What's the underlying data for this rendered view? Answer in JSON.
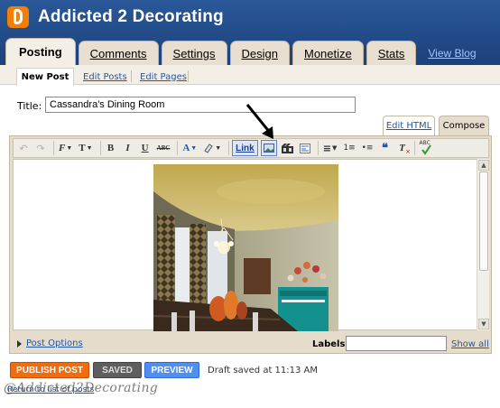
{
  "header": {
    "blog_title": "Addicted 2 Decorating",
    "logo_icon": "blogger-logo-icon",
    "accent": "#f57d00"
  },
  "tabs": [
    {
      "label": "Posting",
      "active": true
    },
    {
      "label": "Comments"
    },
    {
      "label": "Settings"
    },
    {
      "label": "Design"
    },
    {
      "label": "Monetize"
    },
    {
      "label": "Stats"
    }
  ],
  "view_blog": "View Blog",
  "subnav": {
    "new_post": "New Post",
    "edit_posts": "Edit Posts",
    "edit_pages": "Edit Pages"
  },
  "form": {
    "title_label": "Title:",
    "title_value": "Cassandra's Dining Room",
    "edit_html": "Edit HTML",
    "compose": "Compose"
  },
  "toolbar": {
    "undo_icon": "↶",
    "redo_icon": "↷",
    "font_icon": "F",
    "size_icon": "T",
    "bold": "B",
    "italic": "I",
    "underline": "U",
    "strike": "ABC",
    "text_color": "A",
    "link": "Link",
    "align_icon": "≡",
    "numbered_icon": "1≡",
    "bulleted_icon": "•≡",
    "quote_icon": "❝",
    "clear_icon": "T",
    "spell": "ABC"
  },
  "footer": {
    "post_options": "Post Options",
    "labels_label": "Labels:",
    "show_all": "Show all",
    "publish": "PUBLISH POST",
    "saved": "SAVED",
    "preview": "PREVIEW",
    "draft_status": "Draft saved at 11:13 AM",
    "return_link": "Return to list of posts",
    "watermark": "@Addicted2Decorating"
  }
}
